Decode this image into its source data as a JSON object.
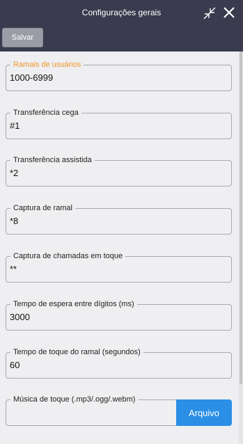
{
  "header": {
    "title": "Configurações gerais",
    "save_label": "Salvar",
    "collapse_icon": "collapse-arrows-icon",
    "close_icon": "close-icon"
  },
  "fields": [
    {
      "label": "Ramais de usuários",
      "value": "1000-6999",
      "focused": true
    },
    {
      "label": "Transferência cega",
      "value": "#1"
    },
    {
      "label": "Transferência assistida",
      "value": "*2"
    },
    {
      "label": "Captura de ramal",
      "value": "*8"
    },
    {
      "label": "Captura de chamadas em toque",
      "value": "**"
    },
    {
      "label": "Tempo de espera entre dígitos (ms)",
      "value": "3000"
    },
    {
      "label": "Tempo de toque do ramal (segundos)",
      "value": "60"
    }
  ],
  "music": {
    "label": "Música de toque (.mp3/.ogg/.webm)",
    "value": "",
    "button_label": "Arquivo"
  },
  "colors": {
    "header_bg": "#3a3b4e",
    "focus_label": "#f0962a",
    "file_button": "#2b8fe6",
    "save_button": "#9b9da6"
  }
}
